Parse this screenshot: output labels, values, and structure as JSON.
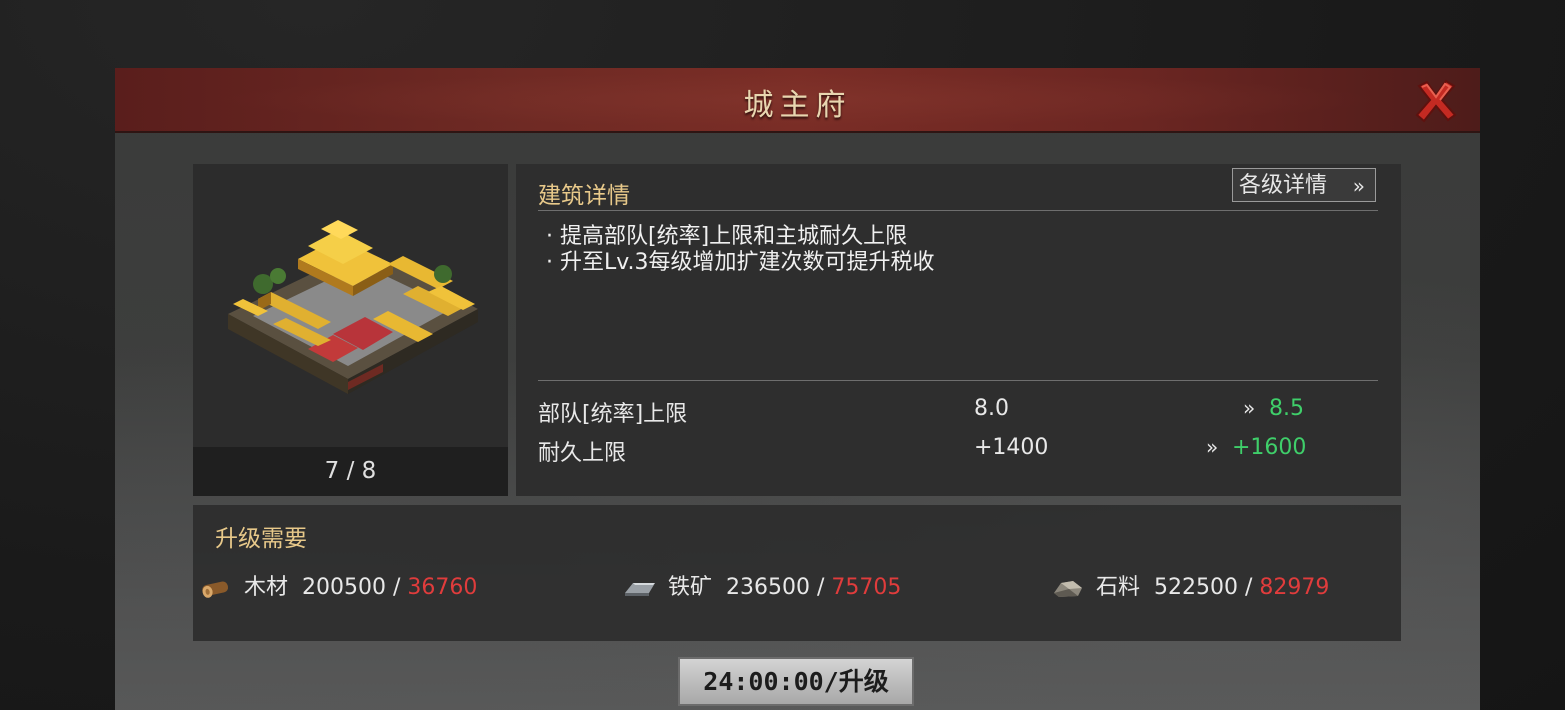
{
  "window": {
    "title": "城主府"
  },
  "building": {
    "level_display": "7 / 8"
  },
  "details": {
    "section_title": "建筑详情",
    "levels_button": "各级详情",
    "levels_button_icon": "double-chevron-right-icon",
    "description": [
      "· 提高部队[统率]上限和主城耐久上限",
      "· 升至Lv.3每级增加扩建次数可提升税收"
    ],
    "stats": [
      {
        "label": "部队[统率]上限",
        "current": "8.0",
        "next": "8.5"
      },
      {
        "label": "耐久上限",
        "current": "+1400",
        "next": "+1600"
      }
    ]
  },
  "requirements": {
    "section_title": "升级需要",
    "resources": [
      {
        "name": "木材",
        "icon": "wood-log-icon",
        "required": "200500",
        "have": "36760"
      },
      {
        "name": "铁矿",
        "icon": "iron-ingot-icon",
        "required": "236500",
        "have": "75705"
      },
      {
        "name": "石料",
        "icon": "stone-icon",
        "required": "522500",
        "have": "82979"
      }
    ],
    "separator": " / "
  },
  "upgrade_button": {
    "label": "24:00:00/升级"
  },
  "colors": {
    "accent_gold": "#e8c98a",
    "increase_green": "#3fcf6a",
    "insufficient_red": "#e03c3c",
    "header_red": "#7a2d26"
  }
}
